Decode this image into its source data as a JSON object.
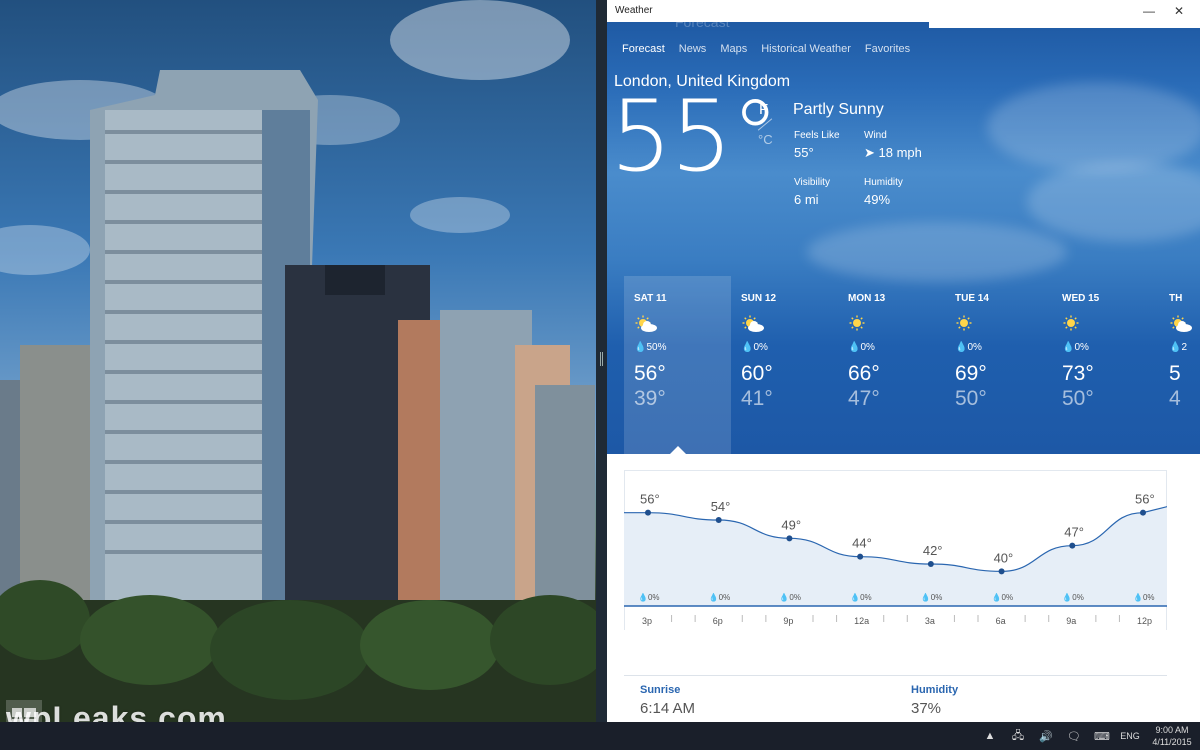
{
  "window": {
    "title": "Weather",
    "minimize": "—",
    "close": "✕",
    "hidden_pivot": "Forecast"
  },
  "watermark": {
    "text": "wpLeaks.com"
  },
  "nav": {
    "tabs": [
      "Forecast",
      "News",
      "Maps",
      "Historical Weather",
      "Favorites"
    ],
    "active": 0
  },
  "current": {
    "location": "London, United Kingdom",
    "temperature": "55°",
    "unit_f": "F",
    "unit_c": "°C",
    "condition": "Partly Sunny",
    "feels_like_label": "Feels Like",
    "feels_like": "55°",
    "wind_label": "Wind",
    "wind": "➤ 18 mph",
    "visibility_label": "Visibility",
    "visibility": "6 mi",
    "humidity_label": "Humidity",
    "humidity": "49%"
  },
  "daily": [
    {
      "name": "SAT 11",
      "icon": "partly-sunny",
      "precip": "💧50%",
      "hi": "56°",
      "lo": "39°",
      "selected": true
    },
    {
      "name": "SUN 12",
      "icon": "partly-sunny",
      "precip": "💧0%",
      "hi": "60°",
      "lo": "41°"
    },
    {
      "name": "MON 13",
      "icon": "sunny",
      "precip": "💧0%",
      "hi": "66°",
      "lo": "47°"
    },
    {
      "name": "TUE 14",
      "icon": "sunny",
      "precip": "💧0%",
      "hi": "69°",
      "lo": "50°"
    },
    {
      "name": "WED 15",
      "icon": "sunny",
      "precip": "💧0%",
      "hi": "73°",
      "lo": "50°"
    },
    {
      "name": "TH",
      "icon": "partly-sunny",
      "precip": "💧2",
      "hi": "5",
      "lo": "4"
    }
  ],
  "chart_data": {
    "type": "area",
    "x": [
      "3p",
      "6p",
      "9p",
      "12a",
      "3a",
      "6a",
      "9a",
      "12p"
    ],
    "values": [
      56,
      54,
      49,
      44,
      42,
      40,
      47,
      56
    ],
    "value_labels": [
      "56°",
      "54°",
      "49°",
      "44°",
      "42°",
      "40°",
      "47°",
      "56°"
    ],
    "precip": [
      "💧0%",
      "💧0%",
      "💧0%",
      "💧0%",
      "💧0%",
      "💧0%",
      "💧0%",
      "💧0%"
    ],
    "ylim": [
      30,
      60
    ],
    "title": "",
    "xlabel": "",
    "ylabel": "",
    "colors": {
      "line": "#2a66b0",
      "fill": "#e6eef7",
      "point": "#1f4f8e"
    }
  },
  "details": [
    {
      "label": "Sunrise",
      "value": "6:14 AM"
    },
    {
      "label": "Humidity",
      "value": "37%"
    }
  ],
  "taskbar": {
    "tray_icons": [
      "network-icon",
      "volume-icon",
      "notification-icon",
      "keyboard-icon"
    ],
    "tray_glyphs": [
      "▲",
      "🖧",
      "🔊",
      "🗨",
      "⌨"
    ],
    "language": "ENG",
    "time": "9:00 AM",
    "date": "4/11/2015"
  }
}
